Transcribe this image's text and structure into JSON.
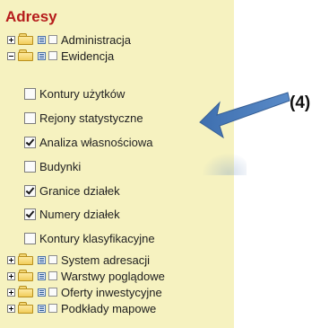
{
  "panel": {
    "title": "Adresy",
    "top_groups": [
      {
        "label": "Administracja"
      },
      {
        "label": "Ewidencja"
      }
    ],
    "layers": [
      {
        "label": "Kontury użytków",
        "checked": false
      },
      {
        "label": "Rejony statystyczne",
        "checked": false
      },
      {
        "label": "Analiza własnościowa",
        "checked": true
      },
      {
        "label": "Budynki",
        "checked": false
      },
      {
        "label": "Granice działek",
        "checked": true
      },
      {
        "label": "Numery działek",
        "checked": true
      },
      {
        "label": "Kontury klasyfikacyjne",
        "checked": false
      }
    ],
    "bottom_groups": [
      {
        "label": "System adresacji"
      },
      {
        "label": "Warstwy poglądowe"
      },
      {
        "label": "Oferty inwestycyjne"
      },
      {
        "label": "Podkłady mapowe"
      }
    ]
  },
  "annotation": {
    "marker": "(4)",
    "arrow_color": "#4f81bd"
  },
  "colors": {
    "panel_bg": "#f6f2c0",
    "title": "#b61c1c"
  }
}
